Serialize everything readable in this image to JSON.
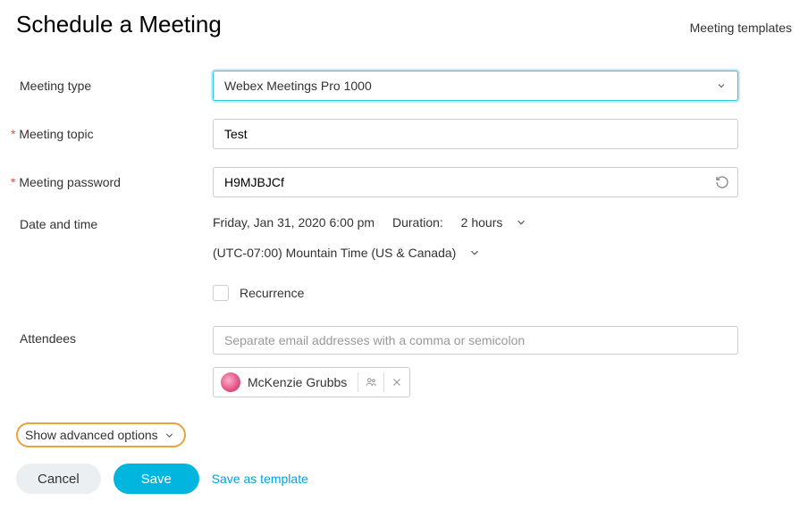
{
  "header": {
    "title": "Schedule a Meeting",
    "templates_link": "Meeting templates"
  },
  "labels": {
    "meeting_type": "Meeting type",
    "meeting_topic": "Meeting topic",
    "meeting_password": "Meeting password",
    "date_time": "Date and time",
    "attendees": "Attendees"
  },
  "fields": {
    "meeting_type_value": "Webex Meetings Pro 1000",
    "meeting_topic_value": "Test",
    "meeting_password_value": "H9MJBJCf",
    "datetime_value": "Friday, Jan 31, 2020 6:00 pm",
    "duration_label": "Duration:",
    "duration_value": "2 hours",
    "timezone_value": "(UTC-07:00) Mountain Time (US & Canada)",
    "recurrence_label": "Recurrence",
    "attendees_placeholder": "Separate email addresses with a comma or semicolon"
  },
  "attendee_chip": {
    "name": "McKenzie Grubbs"
  },
  "advanced": {
    "label": "Show advanced options"
  },
  "buttons": {
    "cancel": "Cancel",
    "save": "Save",
    "save_template": "Save as template"
  }
}
